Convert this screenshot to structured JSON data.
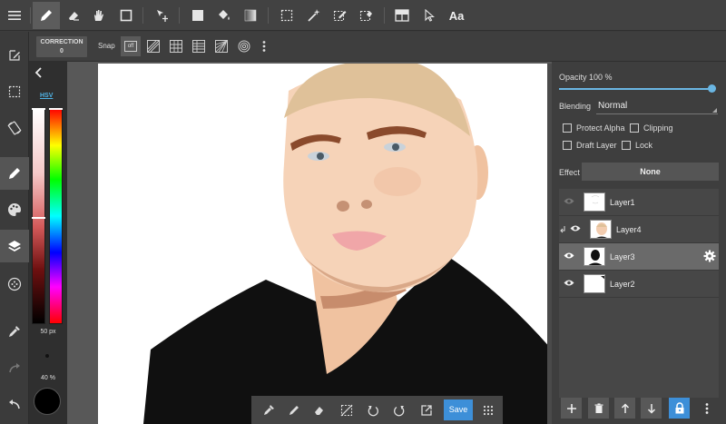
{
  "toolbar": {
    "text_tool_label": "Aa"
  },
  "subbar": {
    "correction_title": "CORRECTION",
    "correction_value": "0",
    "snap_label": "Snap",
    "snap_off_label": "off"
  },
  "colorpanel": {
    "mode_tab": "HSV",
    "brush_size": "50 px",
    "brush_opacity": "40 %",
    "current_color": "#000000"
  },
  "bottombar": {
    "save_label": "Save"
  },
  "layers_panel": {
    "opacity_label": "Opacity 100 %",
    "opacity_value": 1.0,
    "blending_label": "Blending",
    "blending_value": "Normal",
    "protect_alpha_label": "Protect Alpha",
    "clipping_label": "Clipping",
    "draft_layer_label": "Draft Layer",
    "lock_label": "Lock",
    "effect_label": "Effect",
    "effect_value": "None",
    "layers": [
      {
        "name": "Layer1",
        "visible": false,
        "selected": false
      },
      {
        "name": "Layer4",
        "visible": true,
        "selected": false,
        "clipped": true
      },
      {
        "name": "Layer3",
        "visible": true,
        "selected": true
      },
      {
        "name": "Layer2",
        "visible": true,
        "selected": false
      }
    ]
  },
  "colors": {
    "accent": "#3d8fd8",
    "toolbar_bg": "#424242",
    "panel_bg": "#3e3e3e",
    "skin": "#f3cdb0",
    "hair": "#dfc199"
  }
}
